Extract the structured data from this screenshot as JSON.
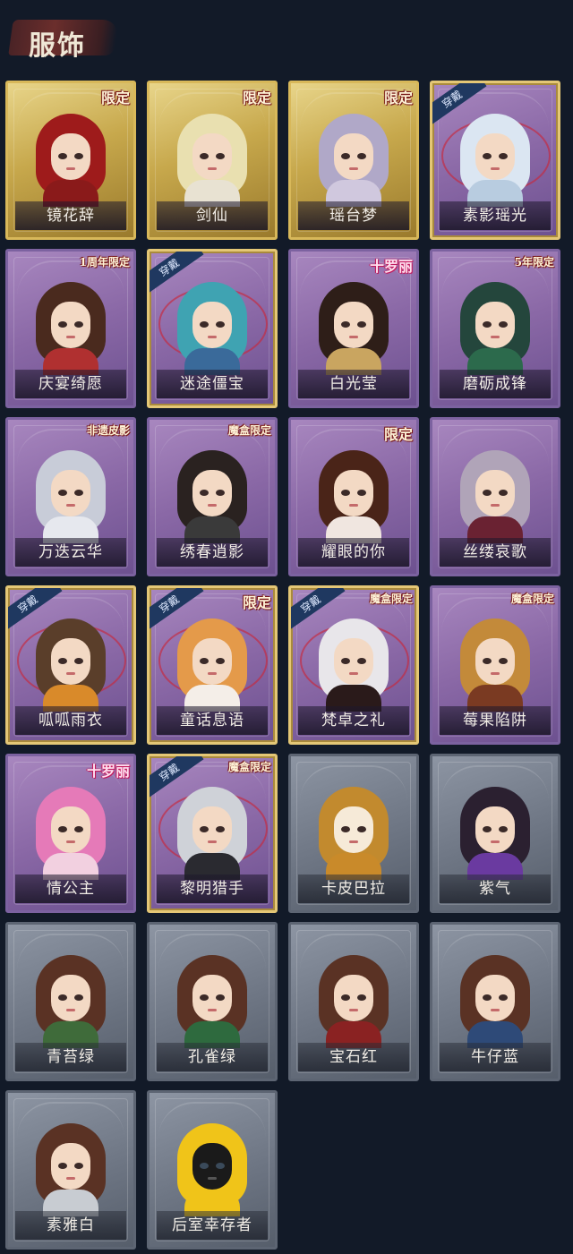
{
  "page_title": "服饰",
  "items": [
    {
      "name": "镜花辞",
      "badge": "限定",
      "worn": false,
      "tier": "gold"
    },
    {
      "name": "剑仙",
      "badge": "限定",
      "worn": false,
      "tier": "gold"
    },
    {
      "name": "瑶台梦",
      "badge": "限定",
      "worn": false,
      "tier": "gold"
    },
    {
      "name": "素影瑶光",
      "badge": "",
      "worn": true,
      "tier": "purple"
    },
    {
      "name": "庆宴绮愿",
      "badge": "1周年限定",
      "worn": false,
      "tier": "purple"
    },
    {
      "name": "迷途僵宝",
      "badge": "",
      "worn": true,
      "tier": "purple"
    },
    {
      "name": "白光莹",
      "badge": "十罗丽",
      "worn": false,
      "tier": "purple"
    },
    {
      "name": "磨砺成锋",
      "badge": "5年限定",
      "worn": false,
      "tier": "purple"
    },
    {
      "name": "万迭云华",
      "badge": "非遗皮影",
      "worn": false,
      "tier": "purple"
    },
    {
      "name": "绣春逍影",
      "badge": "魔盒限定",
      "worn": false,
      "tier": "purple"
    },
    {
      "name": "耀眼的你",
      "badge": "限定",
      "worn": false,
      "tier": "purple"
    },
    {
      "name": "丝缕哀歌",
      "badge": "",
      "worn": false,
      "tier": "purple"
    },
    {
      "name": "呱呱雨衣",
      "badge": "",
      "worn": true,
      "tier": "purple"
    },
    {
      "name": "童话息语",
      "badge": "限定",
      "worn": true,
      "tier": "purple"
    },
    {
      "name": "梵卓之礼",
      "badge": "魔盒限定",
      "worn": true,
      "tier": "purple"
    },
    {
      "name": "莓果陷阱",
      "badge": "魔盒限定",
      "worn": false,
      "tier": "purple"
    },
    {
      "name": "情公主",
      "badge": "十罗丽",
      "worn": false,
      "tier": "purple"
    },
    {
      "name": "黎明猎手",
      "badge": "魔盒限定",
      "worn": true,
      "tier": "purple"
    },
    {
      "name": "卡皮巴拉",
      "badge": "",
      "worn": false,
      "tier": "grey"
    },
    {
      "name": "紫气",
      "badge": "",
      "worn": false,
      "tier": "grey"
    },
    {
      "name": "青苔绿",
      "badge": "",
      "worn": false,
      "tier": "grey"
    },
    {
      "name": "孔雀绿",
      "badge": "",
      "worn": false,
      "tier": "grey"
    },
    {
      "name": "宝石红",
      "badge": "",
      "worn": false,
      "tier": "grey"
    },
    {
      "name": "牛仔蓝",
      "badge": "",
      "worn": false,
      "tier": "grey"
    },
    {
      "name": "素雅白",
      "badge": "",
      "worn": false,
      "tier": "grey"
    },
    {
      "name": "后室幸存者",
      "badge": "",
      "worn": false,
      "tier": "grey"
    }
  ],
  "worn_label": "穿戴",
  "colors": {
    "background": "#121a28",
    "gold": "#d8b85a",
    "purple": "#8a68a6",
    "grey": "#6e7684"
  }
}
